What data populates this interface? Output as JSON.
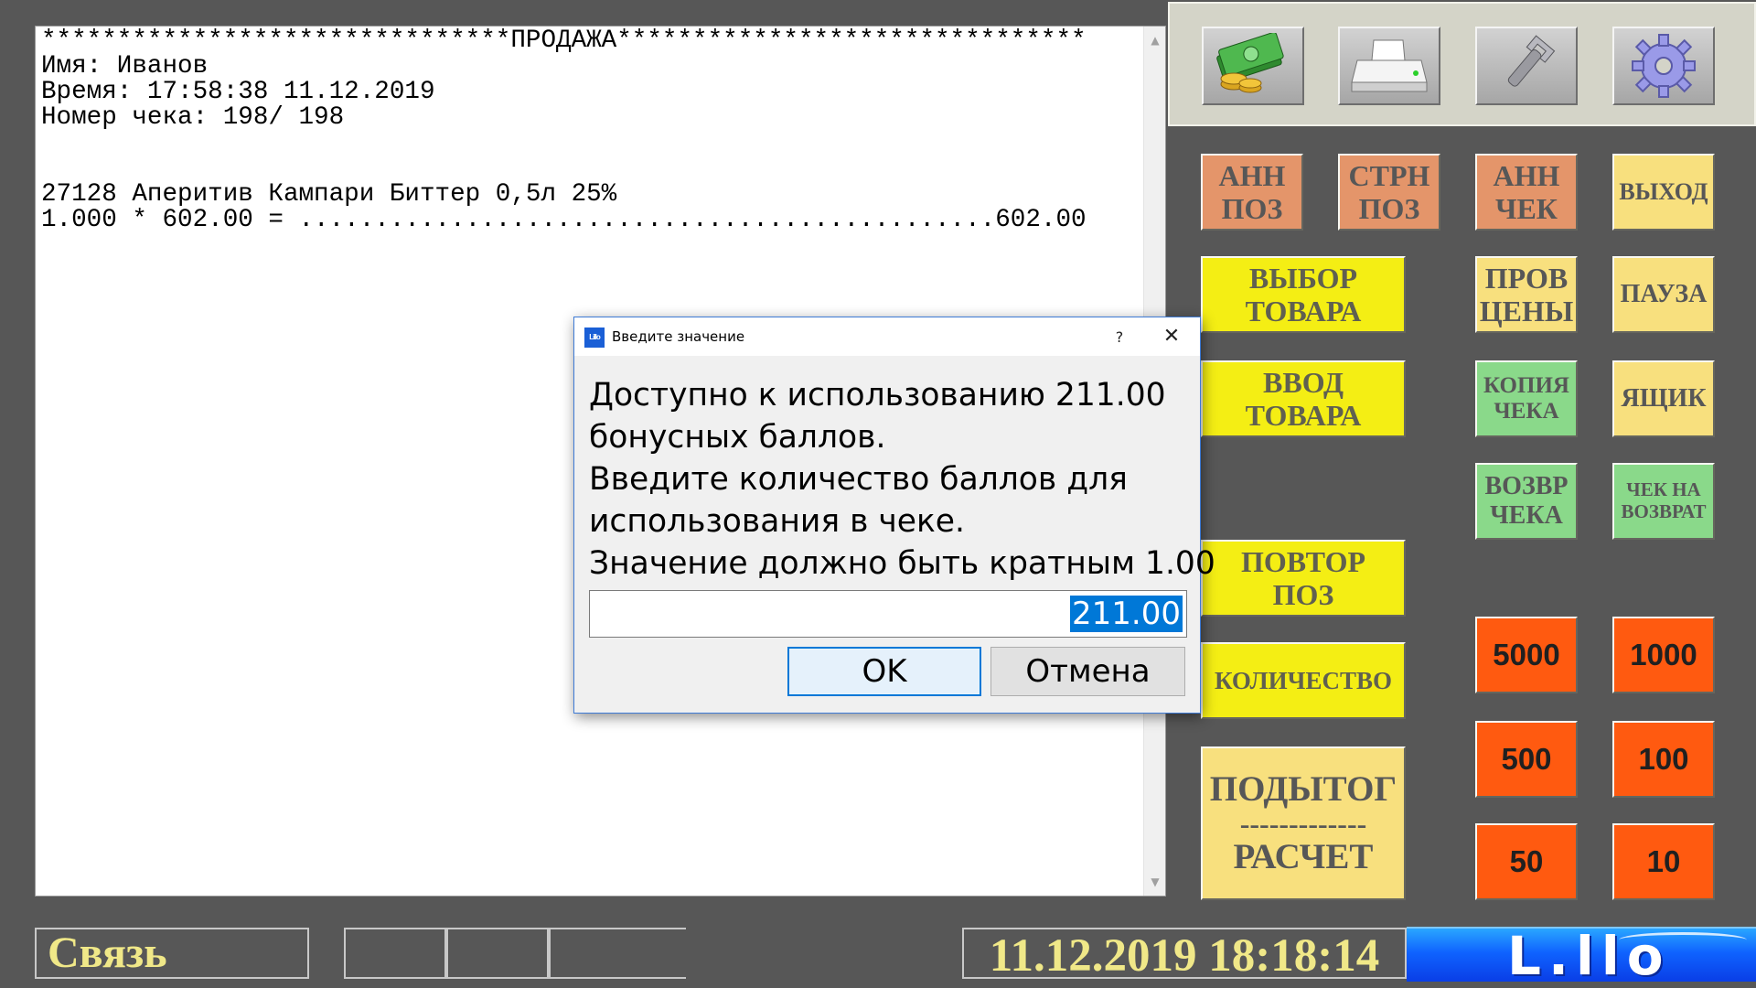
{
  "receipt": {
    "lines": [
      "*******************************ПРОДАЖА*******************************",
      "Имя: Иванов",
      "Время: 17:58:38 11.12.2019",
      "Номер чека: 198/ 198",
      "",
      "",
      "27128 Аперитив Кампари Биттер 0,5л 25%",
      "1.000 * 602.00 = ..............................................602.00"
    ]
  },
  "toolbar": {
    "icons": [
      "money-icon",
      "printer-icon",
      "wrench-icon",
      "gear-icon"
    ]
  },
  "buttons": {
    "ann_pos": "АНН\nПОЗ",
    "strn_pos": "СТРН\nПОЗ",
    "ann_check": "АНН\nЧЕК",
    "exit": "ВЫХОД",
    "select_product": "ВЫБОР\nТОВАРА",
    "check_price": "ПРОВ\nЦЕНЫ",
    "pause": "ПАУЗА",
    "enter_product": "ВВОД\nТОВАРА",
    "check_copy": "КОПИЯ\nЧЕКА",
    "drawer": "ЯЩИК",
    "return_check": "ВОЗВР\nЧЕКА",
    "return_receipt": "ЧЕК НА\nВОЗВРАТ",
    "repeat_pos": "ПОВТОР\nПОЗ",
    "quantity": "КОЛИЧЕСТВО",
    "subtotal": "ПОДЫТОГ",
    "subtotal_sep": "-------------",
    "payment": "РАСЧЕТ",
    "cash_5000": "5000",
    "cash_1000": "1000",
    "cash_500": "500",
    "cash_100": "100",
    "cash_50": "50",
    "cash_10": "10"
  },
  "status": {
    "connection": "Связь",
    "datetime": "11.12.2019 18:18:14",
    "logo": "L.llo"
  },
  "dialog": {
    "title": "Введите значение",
    "icon_label": "Lillo",
    "help": "?",
    "close": "✕",
    "message": [
      "Доступно к использованию 211.00",
      "бонусных баллов.",
      "Введите количество баллов для",
      "использования в чеке.",
      "Значение должно быть кратным 1.00"
    ],
    "input_value": "211.00",
    "ok": "OK",
    "cancel": "Отмена"
  }
}
